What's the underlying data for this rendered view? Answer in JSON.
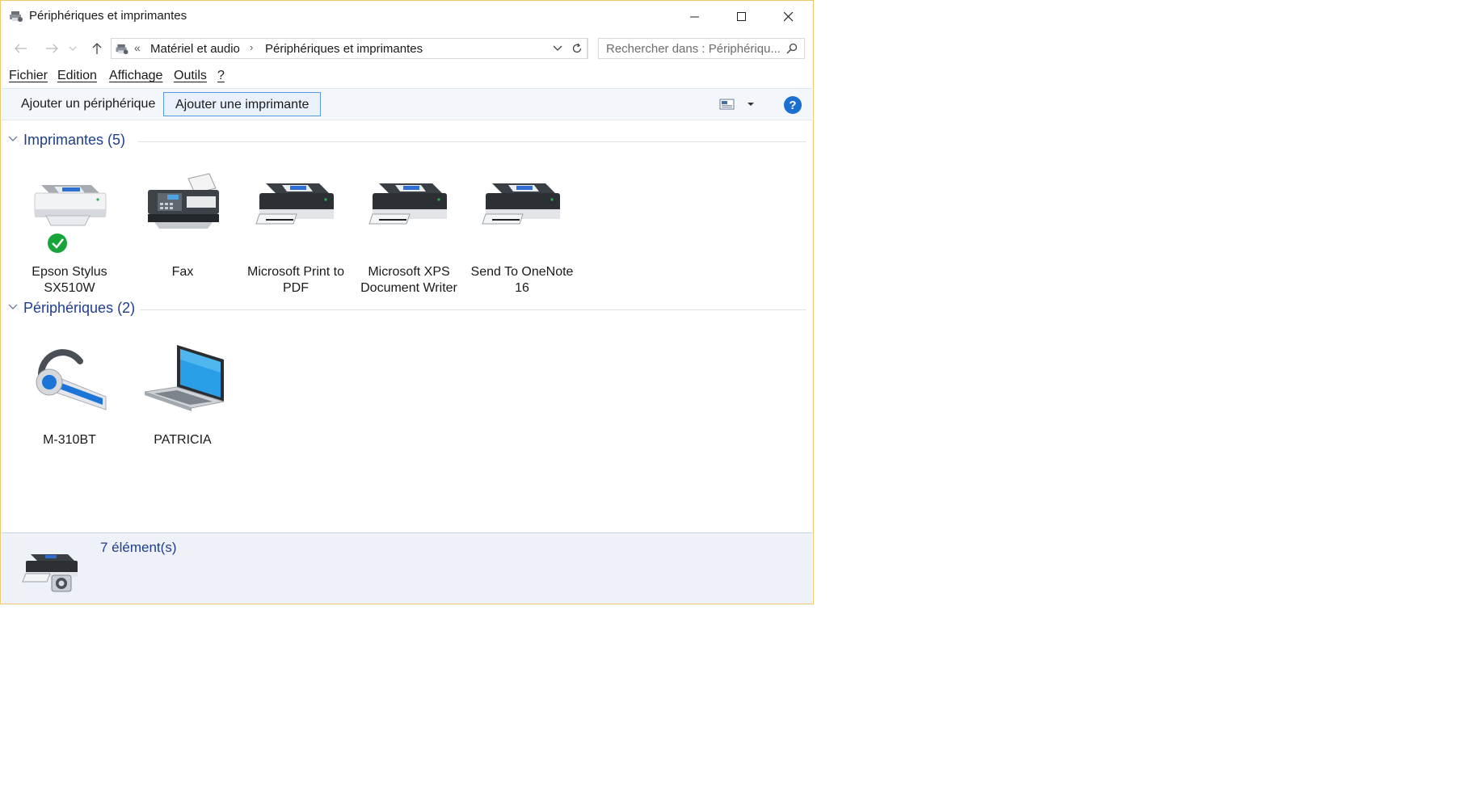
{
  "window": {
    "title": "Périphériques et imprimantes"
  },
  "nav": {
    "crumb_overflow": "«",
    "crumb1": "Matériel et audio",
    "crumb_sep": "›",
    "crumb2": "Périphériques et imprimantes",
    "search_placeholder": "Rechercher dans : Périphériqu..."
  },
  "menu": [
    "Fichier",
    "Edition",
    "Affichage",
    "Outils",
    "?"
  ],
  "toolbar": {
    "add_device": "Ajouter un périphérique",
    "add_printer": "Ajouter une imprimante",
    "help": "?"
  },
  "groups": {
    "printers": {
      "title": "Imprimantes (5)",
      "items": [
        {
          "line1": "Epson Stylus",
          "line2": "SX510W",
          "icon": "printer-light-icon",
          "default": true
        },
        {
          "line1": "Fax",
          "line2": "",
          "icon": "fax-icon"
        },
        {
          "line1": "Microsoft Print to",
          "line2": "PDF",
          "icon": "printer-dark-icon"
        },
        {
          "line1": "Microsoft XPS",
          "line2": "Document Writer",
          "icon": "printer-dark-icon"
        },
        {
          "line1": "Send To OneNote",
          "line2": "16",
          "icon": "printer-dark-icon"
        }
      ]
    },
    "devices": {
      "title": "Périphériques (2)",
      "items": [
        {
          "line1": "M-310BT",
          "line2": "",
          "icon": "headset-icon"
        },
        {
          "line1": "PATRICIA",
          "line2": "",
          "icon": "laptop-icon"
        }
      ]
    }
  },
  "status": {
    "count": "7 élément(s)"
  },
  "colors": {
    "accent": "#1e3e8c",
    "window_border": "#f0c76a",
    "help": "#1a6fd1",
    "default_check": "#17a53a"
  }
}
